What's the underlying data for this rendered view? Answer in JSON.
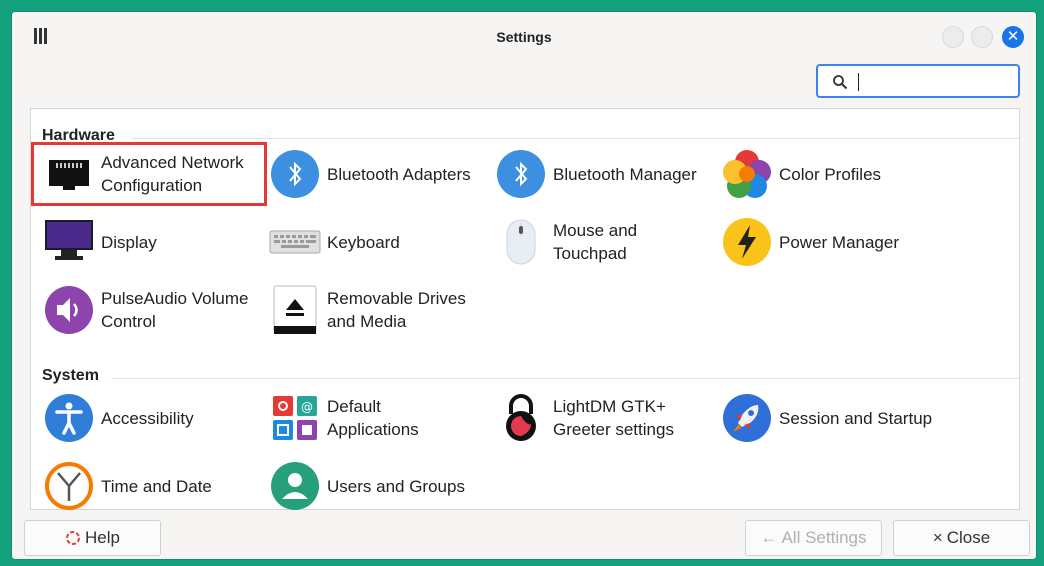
{
  "window": {
    "title": "Settings"
  },
  "search": {
    "value": ""
  },
  "sections": [
    {
      "label": "Hardware",
      "items": [
        {
          "label": "Advanced Network\nConfiguration",
          "icon": "network-port-icon"
        },
        {
          "label": "Bluetooth Adapters",
          "icon": "bluetooth-icon"
        },
        {
          "label": "Bluetooth Manager",
          "icon": "bluetooth-icon"
        },
        {
          "label": "Color Profiles",
          "icon": "color-profiles-icon"
        },
        {
          "label": "Display",
          "icon": "display-icon"
        },
        {
          "label": "Keyboard",
          "icon": "keyboard-icon"
        },
        {
          "label": "Mouse and\nTouchpad",
          "icon": "mouse-icon"
        },
        {
          "label": "Power Manager",
          "icon": "power-icon"
        },
        {
          "label": "PulseAudio Volume\nControl",
          "icon": "volume-icon"
        },
        {
          "label": "Removable Drives\nand Media",
          "icon": "eject-icon"
        }
      ]
    },
    {
      "label": "System",
      "items": [
        {
          "label": "Accessibility",
          "icon": "accessibility-icon"
        },
        {
          "label": "Default\nApplications",
          "icon": "default-apps-icon"
        },
        {
          "label": "LightDM GTK+\nGreeter settings",
          "icon": "lock-icon"
        },
        {
          "label": "Session and Startup",
          "icon": "rocket-icon"
        },
        {
          "label": "Time and Date",
          "icon": "clock-icon"
        },
        {
          "label": "Users and Groups",
          "icon": "users-icon"
        }
      ]
    }
  ],
  "footer": {
    "help_label": "Help",
    "all_settings_label": "All Settings",
    "close_label": "Close"
  },
  "colors": {
    "background": "#13a07c",
    "accent": "#1a73e8",
    "highlight": "#e53935"
  }
}
